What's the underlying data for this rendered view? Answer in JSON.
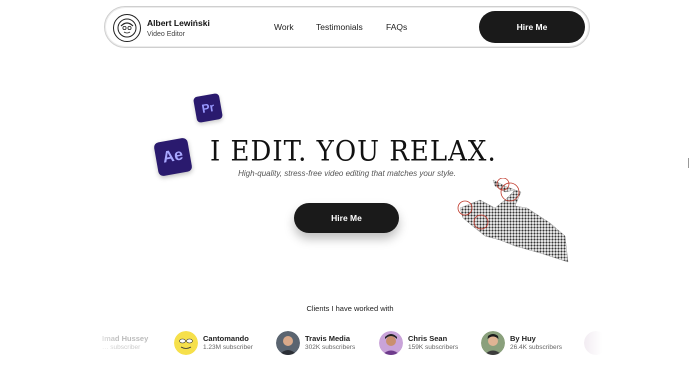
{
  "nav": {
    "name": "Albert Lewiński",
    "role": "Video Editor",
    "links": [
      "Work",
      "Testimonials",
      "FAQs"
    ],
    "cta": "Hire Me"
  },
  "hero": {
    "badges": {
      "premiere": "Pr",
      "after_effects": "Ae"
    },
    "headline": "I EDIT. YOU RELAX.",
    "subtitle": "High-quality, stress-free video editing that matches your style.",
    "cta": "Hire Me"
  },
  "clients": {
    "title": "Clients I have worked with",
    "items": [
      {
        "name": " Imad Hussey",
        "subs": "… subscriber"
      },
      {
        "name": "Cantomando",
        "subs": "1.23M subscriber"
      },
      {
        "name": "Travis Media",
        "subs": "302K subscribers"
      },
      {
        "name": "Chris Sean",
        "subs": "159K subscribers"
      },
      {
        "name": "By Huy",
        "subs": "26.4K subscribers"
      }
    ]
  },
  "colors": {
    "dark": "#1a1a1a",
    "adobe_purple": "#2a1a6e"
  }
}
